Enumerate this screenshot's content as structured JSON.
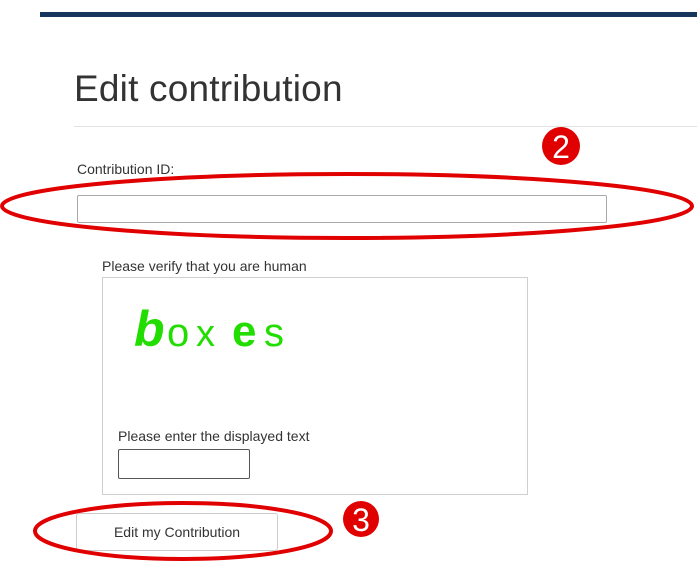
{
  "header": {
    "accent_color": "#17365d"
  },
  "form": {
    "title": "Edit contribution",
    "contribution_id_label": "Contribution ID:",
    "contribution_id_value": "",
    "verify_label": "Please verify that you are human",
    "captcha_text": "boxes",
    "captcha_color": "#22dd00",
    "captcha_input_label": "Please enter the displayed text",
    "captcha_input_value": "",
    "submit_label": "Edit my Contribution"
  },
  "annotations": {
    "color": "#e00000",
    "markers": [
      {
        "number": "2",
        "target": "contribution-id-input"
      },
      {
        "number": "3",
        "target": "edit-contribution-button"
      }
    ]
  }
}
